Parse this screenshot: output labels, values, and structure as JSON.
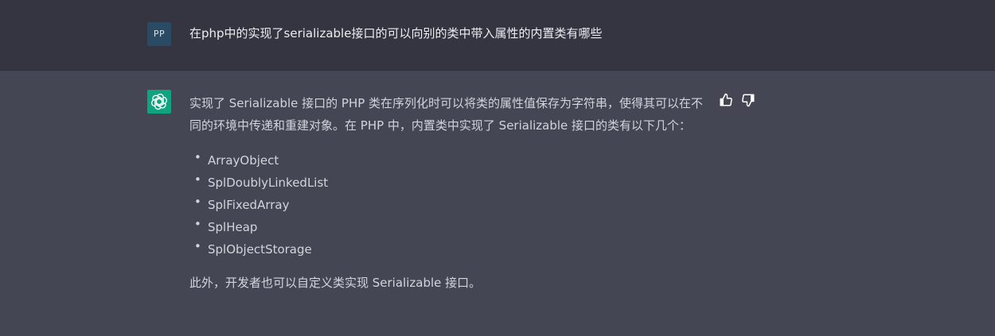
{
  "user": {
    "avatar_initials": "PP",
    "message": "在php中的实现了serializable接口的可以向别的类中带入属性的内置类有哪些"
  },
  "assistant": {
    "intro": "实现了 Serializable 接口的 PHP 类在序列化时可以将类的属性值保存为字符串，使得其可以在不同的环境中传递和重建对象。在 PHP 中，内置类中实现了 Serializable 接口的类有以下几个：",
    "classes": [
      "ArrayObject",
      "SplDoublyLinkedList",
      "SplFixedArray",
      "SplHeap",
      "SplObjectStorage"
    ],
    "conclusion": "此外，开发者也可以自定义类实现 Serializable 接口。",
    "bullet_char": "•"
  },
  "icons": {
    "bot_avatar": "openai-logo-icon",
    "thumbs_up": "thumbs-up-icon",
    "thumbs_down": "thumbs-down-icon"
  },
  "colors": {
    "user_row_bg": "#343541",
    "assistant_row_bg": "#444654",
    "bot_avatar_bg": "#10a37f",
    "user_avatar_bg": "#2b4a63",
    "text": "#d1d5db"
  }
}
